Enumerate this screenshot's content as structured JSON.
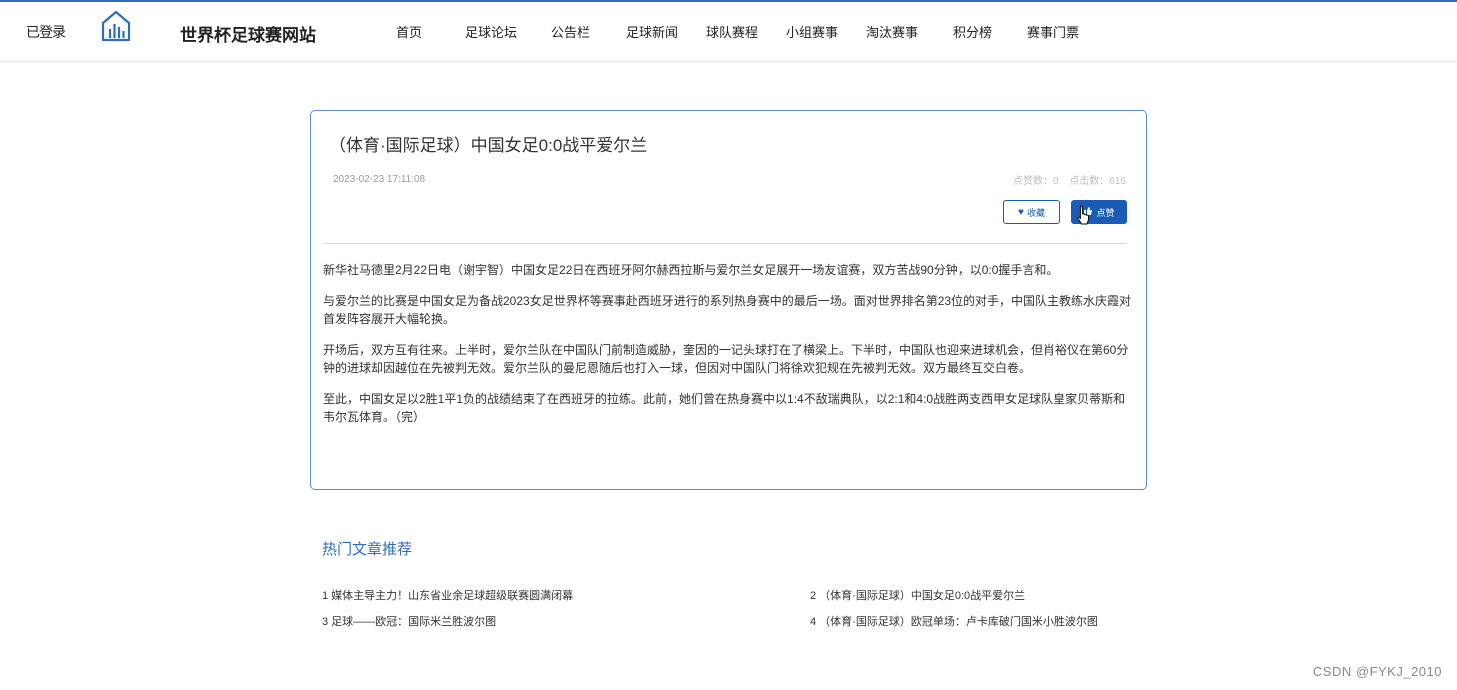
{
  "header": {
    "left_text": "已登录",
    "site_title": "世界杯足球赛网站",
    "nav": [
      {
        "label": "首页"
      },
      {
        "label": "足球论坛"
      },
      {
        "label": "公告栏"
      },
      {
        "label": "足球新闻"
      },
      {
        "label": "球队赛程"
      },
      {
        "label": "小组赛事"
      },
      {
        "label": "淘汰赛事"
      },
      {
        "label": "积分榜"
      },
      {
        "label": "赛事门票"
      }
    ]
  },
  "article": {
    "title": "（体育·国际足球）中国女足0:0战平爱尔兰",
    "date": "2023-02-23 17:11:08",
    "likes_label": "点赞数：0",
    "clicks_label": "点击数：616",
    "favorite_label": "收藏",
    "like_label": "点赞",
    "paragraphs": [
      "新华社马德里2月22日电（谢宇智）中国女足22日在西班牙阿尔赫西拉斯与爱尔兰女足展开一场友谊赛，双方苦战90分钟，以0:0握手言和。",
      "与爱尔兰的比赛是中国女足为备战2023女足世界杯等赛事赴西班牙进行的系列热身赛中的最后一场。面对世界排名第23位的对手，中国队主教练水庆霞对首发阵容展开大幅轮换。",
      "开场后，双方互有往来。上半时，爱尔兰队在中国队门前制造威胁，奎因的一记头球打在了横梁上。下半时，中国队也迎来进球机会，但肖裕仪在第60分钟的进球却因越位在先被判无效。爱尔兰队的曼尼恩随后也打入一球，但因对中国队门将徐欢犯规在先被判无效。双方最终互交白卷。",
      "至此，中国女足以2胜1平1负的战绩结束了在西班牙的拉练。此前，她们曾在热身赛中以1:4不敌瑞典队，以2:1和4:0战胜两支西甲女足球队皇家贝蒂斯和韦尔瓦体育。（完）"
    ]
  },
  "hot": {
    "title": "热门文章推荐",
    "items": [
      {
        "label": "1  媒体主导主力！山东省业余足球超级联赛圆满闭幕"
      },
      {
        "label": "2  （体育·国际足球）中国女足0:0战平爱尔兰"
      },
      {
        "label": "3  足球——欧冠：国际米兰胜波尔图"
      },
      {
        "label": "4  （体育·国际足球）欧冠单场：卢卡库破门国米小胜波尔图"
      }
    ]
  },
  "watermark": "CSDN @FYKJ_2010",
  "colors": {
    "accent": "#2f6cc0",
    "button": "#1a5bb5",
    "card_border": "#5d8fd0"
  },
  "icons": {
    "logo": "bar-chart-house-icon",
    "favorite": "heart-icon",
    "like": "thumbs-up-icon"
  }
}
